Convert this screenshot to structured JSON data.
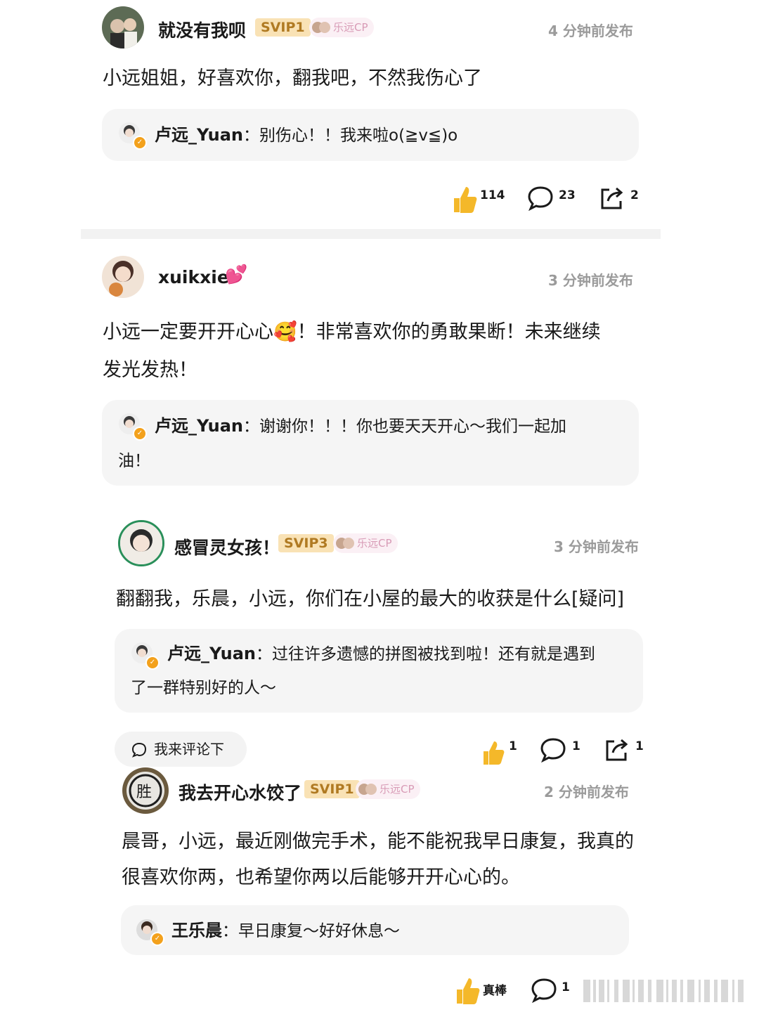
{
  "colors": {
    "svip_bg": "#f9e2b5",
    "svip_text": "#b07a22",
    "thumb": "#f4b82a",
    "verify": "#f3a11c",
    "reply_bg": "#f5f5f5"
  },
  "comments": [
    {
      "username": "就没有我呗",
      "badge": "SVIP1",
      "cp_tag": "乐远CP",
      "time": "4 分钟前发布",
      "content": "小远姐姐，好喜欢你，翻我吧，不然我伤心了",
      "reply": {
        "name": "卢远_Yuan",
        "sep": "：",
        "text": "别伤心！！我来啦o(≧v≦)o"
      },
      "actions": {
        "likes": "114",
        "comments": "23",
        "shares": "2"
      }
    },
    {
      "username": "xuikxie",
      "emoji": "💕",
      "time": "3 分钟前发布",
      "content_line1": "小远一定要开开心心🥰！非常喜欢你的勇敢果断！未来继续",
      "content_line2": "发光发热！",
      "reply": {
        "name": "卢远_Yuan",
        "sep": "：",
        "text_line1": "谢谢你！！！你也要天天开心～我们一起加",
        "text_line2": "油！"
      }
    },
    {
      "username": "感冒灵女孩！",
      "badge": "SVIP3",
      "cp_tag": "乐远CP",
      "time": "3 分钟前发布",
      "content": "翻翻我，乐晨，小远，你们在小屋的最大的收获是什么[疑问]",
      "reply": {
        "name": "卢远_Yuan",
        "sep": "：",
        "text_line1": "过往许多遗憾的拼图被找到啦！还有就是遇到",
        "text_line2": "了一群特别好的人～"
      },
      "comment_button": "我来评论下",
      "actions": {
        "likes": "1",
        "comments": "1",
        "shares": "1"
      }
    },
    {
      "username": "我去开心水饺了",
      "badge": "SVIP1",
      "cp_tag": "乐远CP",
      "time": "2 分钟前发布",
      "content_line1": "晨哥，小远，最近刚做完手术，能不能祝我早日康复，我真的",
      "content_line2": "很喜欢你两，也希望你两以后能够开开心心的。",
      "reply": {
        "name": "王乐晨",
        "sep": "：",
        "text": "早日康复～好好休息～"
      },
      "actions": {
        "likes": "真棒",
        "comments": "1"
      }
    }
  ]
}
